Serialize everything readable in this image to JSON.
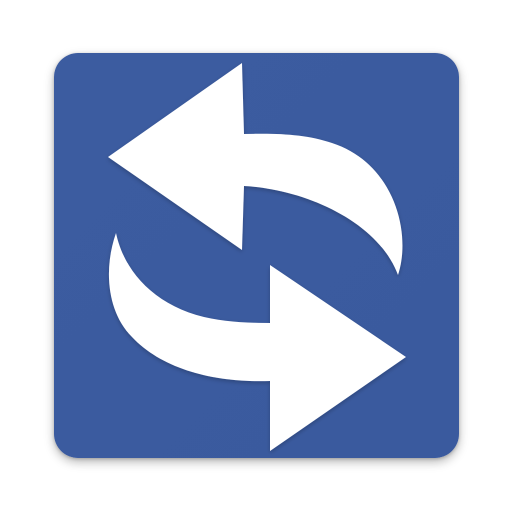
{
  "app_icon": {
    "icon_name": "sync-arrows-icon",
    "background_color": "#3C5CA0",
    "background_gradient_end": "#3A5A9E",
    "arrow_color": "#FFFFFF"
  }
}
